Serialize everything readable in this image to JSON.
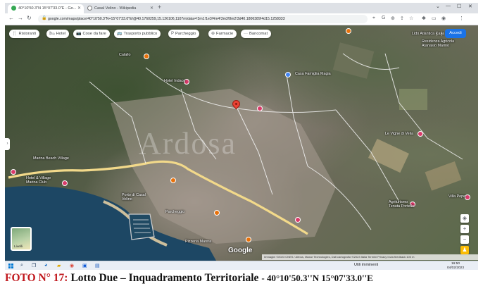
{
  "browser": {
    "tabs": [
      {
        "label": "40°10'50.3\"N 15°07'33.0\"E - Go...",
        "active": true
      },
      {
        "label": "Casal Velino - Wikipedia",
        "active": false
      }
    ],
    "new_tab": "+",
    "url": "google.com/maps/place/40°10'50.3\"N+15°07'33.0\"E/@40.1760259,15.126106,1107m/data=!3m1!1e3!4m4!3m3!8m2!3d40.1806389!4d15.1258333"
  },
  "map": {
    "filter_chips": [
      {
        "icon": "fork-knife-icon",
        "glyph": "🍴",
        "label": "Ristoranti"
      },
      {
        "icon": "bed-icon",
        "glyph": "🛏",
        "label": "Hotel"
      },
      {
        "icon": "camera-icon",
        "glyph": "📷",
        "label": "Cose da fare"
      },
      {
        "icon": "bus-icon",
        "glyph": "🚌",
        "label": "Trasporto pubblico"
      },
      {
        "icon": "parking-icon",
        "glyph": "P",
        "label": "Parcheggio"
      },
      {
        "icon": "pharmacy-icon",
        "glyph": "⊕",
        "label": "Farmacie"
      },
      {
        "icon": "more-icon",
        "glyph": "···",
        "label": "Bancomat"
      }
    ],
    "signin_label": "Accedi",
    "place_labels": [
      "Lido Atlantica Casa",
      "Residenza Agricola Atanasio Marino",
      "Calallo",
      "Hotel Indaco",
      "Casa Famiglia Magia",
      "Marina Beach Village",
      "Hotel & Village Marina Club",
      "Le Vigne di Velia",
      "Agriturismo Tenuta Portello",
      "Villa Pepe",
      "Porto di Casal Velino",
      "Parcheggio",
      "Pizzeria Manna"
    ],
    "watermark": "Ardosa",
    "layers_label": "Livelli",
    "google_logo": "Google",
    "attribution": "Immagini ©2023 CNES / Airbus, Maxar Technologies, Dati cartografici ©2023   Italia   Termini   Privacy   Invia feedback   100 m"
  },
  "taskbar": {
    "weather": "Utili imminenti",
    "time": "16:50",
    "date": "04/02/2023"
  },
  "caption": {
    "foto_label": "FOTO N° 17:",
    "title": "Lotto Due – Inquadramento Territoriale",
    "coords": "- 40°10'50.3''N 15°07'33.0''E"
  },
  "colors": {
    "caption_red": "#c0171c",
    "accent_blue": "#1a73e8",
    "pin_red": "#ea4335"
  }
}
